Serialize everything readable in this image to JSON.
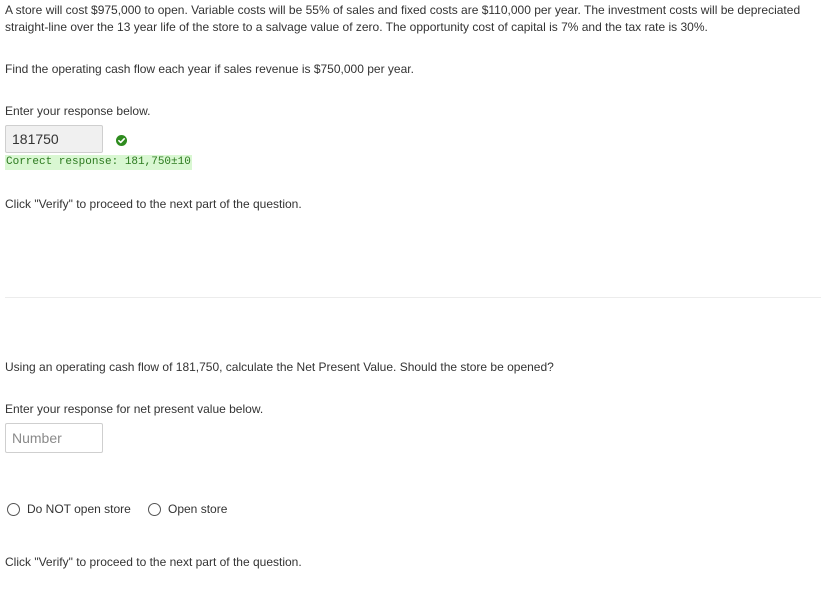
{
  "question": {
    "prompt": "A store will cost $975,000 to open. Variable costs will be 55% of sales and fixed costs are $110,000 per year. The investment costs will be depreciated straight-line over the 13 year life of the store to a salvage value of zero. The opportunity cost of capital is 7% and the tax rate is 30%."
  },
  "part1": {
    "instruction": "Find the operating cash flow each year if sales revenue is $750,000 per year.",
    "response_label": "Enter your response below.",
    "answer_value": "181750",
    "status_icon": "check-circle-icon",
    "feedback": "Correct response: 181,750±10",
    "verify_note": "Click \"Verify\" to proceed to the next part of the question."
  },
  "part2": {
    "instruction": "Using an operating cash flow of 181,750, calculate the Net Present Value. Should the store be opened?",
    "response_label": "Enter your response for net present value below.",
    "npv_placeholder": "Number",
    "options": [
      {
        "label": "Do NOT open store"
      },
      {
        "label": "Open store"
      }
    ],
    "verify_note": "Click \"Verify\" to proceed to the next part of the question."
  },
  "colors": {
    "success_green": "#2e8b1e",
    "feedback_bg": "#d9f7d2",
    "text": "#333333"
  }
}
